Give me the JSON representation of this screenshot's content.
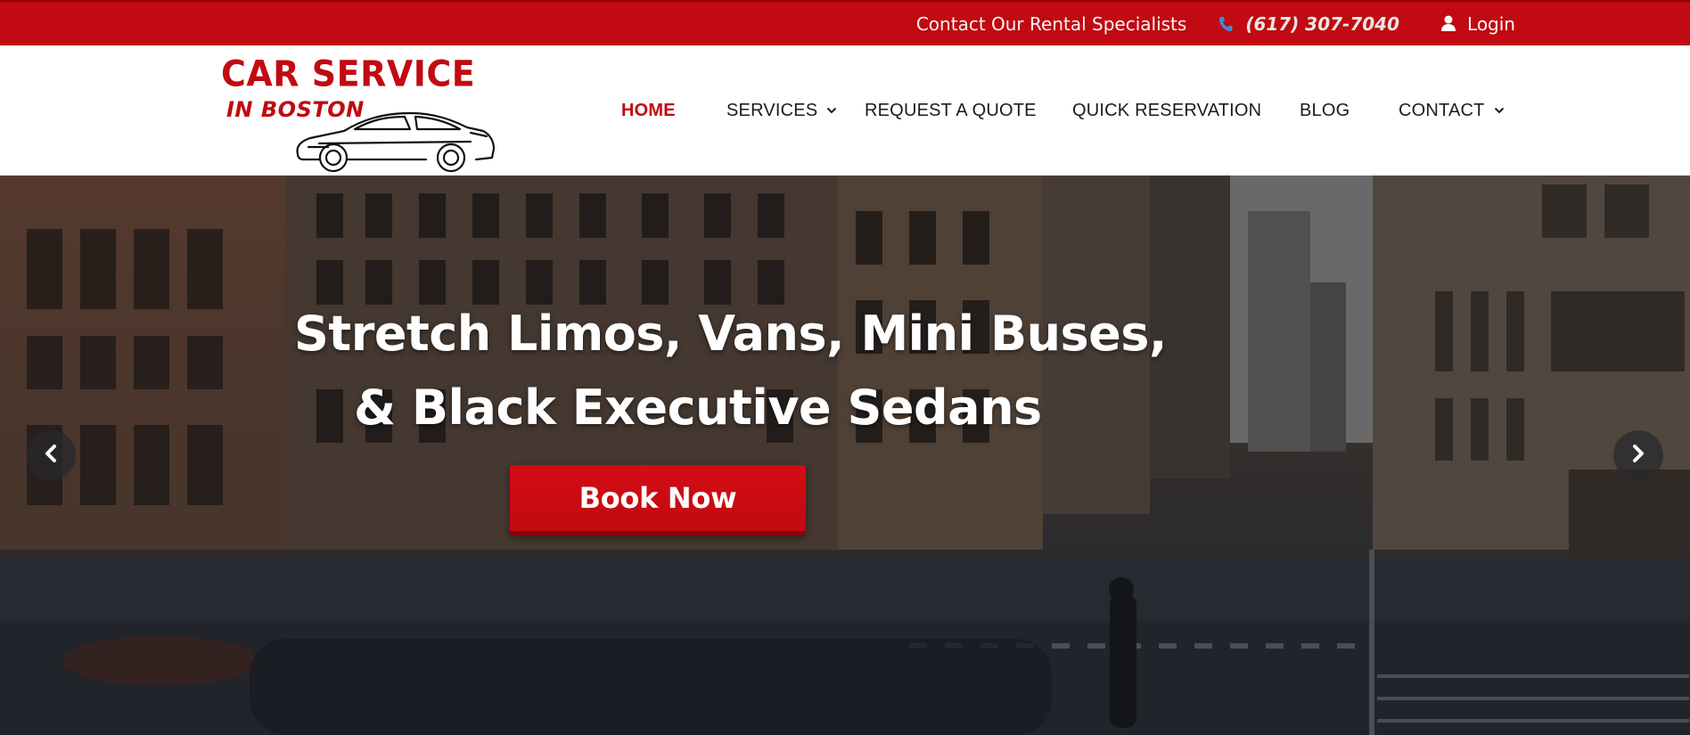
{
  "topbar": {
    "contact_text": "Contact Our Rental Specialists",
    "phone": "(617) 307-7040",
    "login_label": "Login",
    "background_color": "#c10a11"
  },
  "logo": {
    "line1": "CAR SERVICE",
    "line2": "IN BOSTON"
  },
  "nav": {
    "items": [
      {
        "label": "HOME",
        "active": true,
        "has_dropdown": false
      },
      {
        "label": "SERVICES",
        "active": false,
        "has_dropdown": true
      },
      {
        "label": "REQUEST A QUOTE",
        "active": false,
        "has_dropdown": false
      },
      {
        "label": "QUICK RESERVATION",
        "active": false,
        "has_dropdown": false
      },
      {
        "label": "BLOG",
        "active": false,
        "has_dropdown": false
      },
      {
        "label": "CONTACT",
        "active": false,
        "has_dropdown": true
      }
    ],
    "active_color": "#c10a11"
  },
  "hero": {
    "title_line1": "Stretch Limos, Vans, Mini Buses,",
    "title_line2": "& Black Executive Sedans",
    "cta_label": "Book Now",
    "cta_color": "#c10a11"
  },
  "icons": {
    "phone": "phone-icon",
    "user": "user-icon",
    "chevron": "chevron-down-icon",
    "prev": "chevron-left-icon",
    "next": "chevron-right-icon"
  }
}
